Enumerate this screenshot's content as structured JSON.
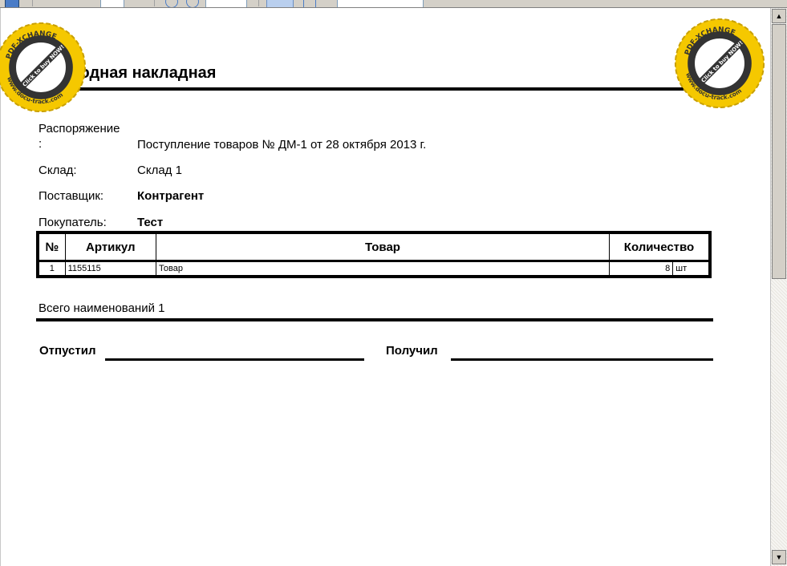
{
  "toolbar": {
    "page_input": "",
    "zoom_input": "",
    "find_input": ""
  },
  "document": {
    "title": "Приходная накладная",
    "fields": [
      {
        "label": "Распоряжение",
        "label_suffix": ":",
        "value": "Поступление товаров № ДМ-1 от 28 октября 2013 г."
      },
      {
        "label": "Склад:",
        "value": "Склад 1"
      },
      {
        "label": "Поставщик:",
        "value": "Контрагент"
      },
      {
        "label": "Покупатель:",
        "value": "Тест"
      }
    ],
    "table": {
      "headers": [
        "№",
        "Артикул",
        "Товар",
        "Количество"
      ],
      "rows": [
        {
          "num": "1",
          "article": "1155115",
          "product": "Товар",
          "qty": "8",
          "unit": "шт"
        }
      ]
    },
    "summary": "Всего наименований 1",
    "signatures": {
      "released": "Отпустил",
      "received": "Получил"
    }
  },
  "watermark": {
    "arc_top": "PDF-XCHANGE",
    "diagonal": "Click to buy NOW!",
    "arc_bottom": "www.docu-track.com",
    "ring_color": "#f5c800",
    "center_color": "#333333"
  },
  "scrollbar": {
    "up_icon": "▲",
    "down_icon": "▼"
  }
}
